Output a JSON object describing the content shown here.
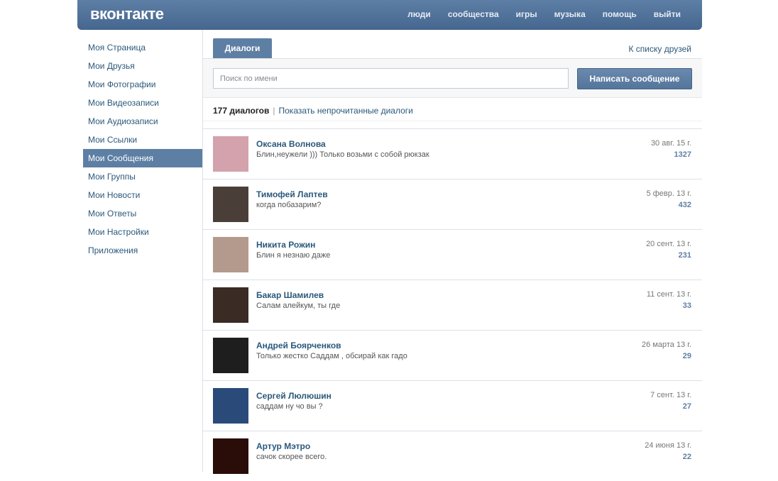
{
  "header": {
    "logo": "вконтакте",
    "nav": [
      "люди",
      "сообщества",
      "игры",
      "музыка",
      "помощь",
      "выйти"
    ]
  },
  "sidebar": {
    "items": [
      {
        "label": "Моя Страница",
        "active": false
      },
      {
        "label": "Мои Друзья",
        "active": false
      },
      {
        "label": "Мои Фотографии",
        "active": false
      },
      {
        "label": "Мои Видеозаписи",
        "active": false
      },
      {
        "label": "Мои Аудиозаписи",
        "active": false
      },
      {
        "label": "Мои Ссылки",
        "active": false
      },
      {
        "label": "Мои Сообщения",
        "active": true
      },
      {
        "label": "Мои Группы",
        "active": false
      },
      {
        "label": "Мои Новости",
        "active": false
      },
      {
        "label": "Мои Ответы",
        "active": false
      },
      {
        "label": "Мои Настройки",
        "active": false
      },
      {
        "label": "Приложения",
        "active": false
      }
    ]
  },
  "main": {
    "tab_label": "Диалоги",
    "friends_link": "К списку друзей",
    "search_placeholder": "Поиск по имени",
    "write_button": "Написать сообщение",
    "dialog_count": "177 диалогов",
    "separator": "|",
    "unread_link": "Показать непрочитанные диалоги"
  },
  "dialogs": [
    {
      "name": "Оксана Волнова",
      "message": "Блин,неужели ))) Только возьми с собой рюкзак",
      "date": "30 авг. 15 г.",
      "count": "1327",
      "avatar_color": "#d4a2ad"
    },
    {
      "name": "Тимофей Лаптев",
      "message": "когда побазарим?",
      "date": "5 февр. 13 г.",
      "count": "432",
      "avatar_color": "#4a3f38"
    },
    {
      "name": "Никита Рожин",
      "message": "Блин я незнаю даже",
      "date": "20 сент. 13 г.",
      "count": "231",
      "avatar_color": "#b39a8c"
    },
    {
      "name": "Бакар Шамилев",
      "message": "Салам алейкум, ты где",
      "date": "11 сент. 13 г.",
      "count": "33",
      "avatar_color": "#3a2b25"
    },
    {
      "name": "Андрей Боярченков",
      "message": "Только жестко Саддам , обсирай как гадо",
      "date": "26 марта 13 г.",
      "count": "29",
      "avatar_color": "#1e1e1e"
    },
    {
      "name": "Сергей Люлюшин",
      "message": "саддам ну чо вы ?",
      "date": "7 сент. 13 г.",
      "count": "27",
      "avatar_color": "#2a4a7a"
    },
    {
      "name": "Артур Мэтро",
      "message": "сачок скорее всего.",
      "date": "24 июня 13 г.",
      "count": "22",
      "avatar_color": "#2a0c08"
    }
  ]
}
